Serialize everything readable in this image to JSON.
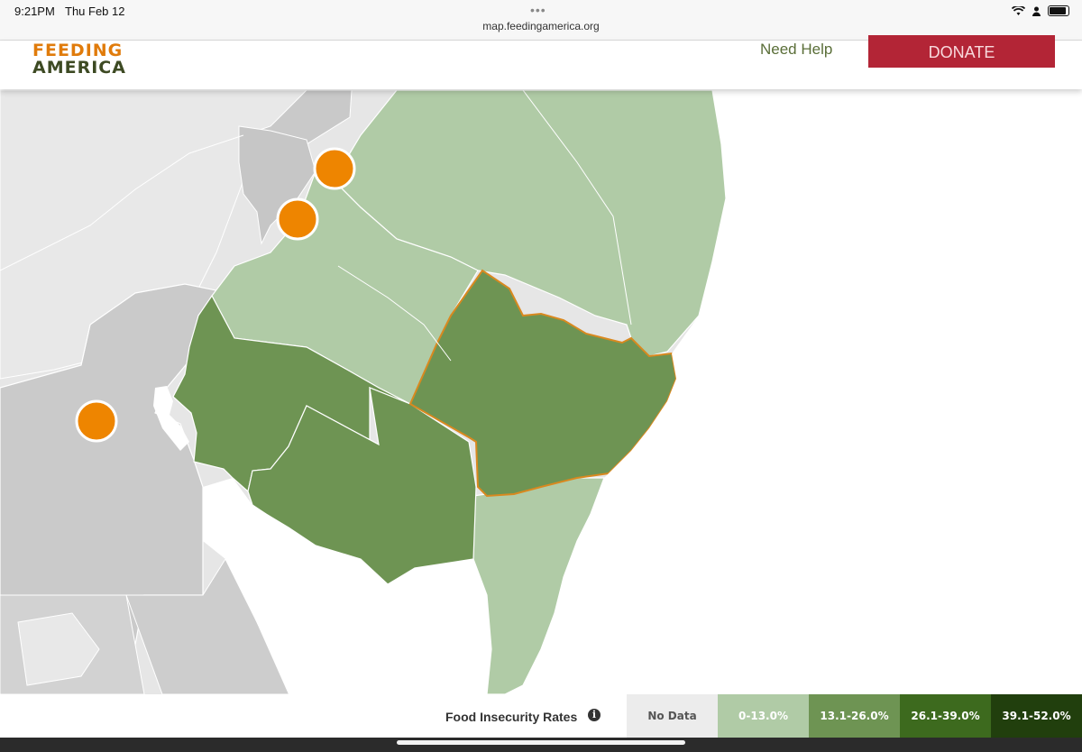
{
  "status_bar": {
    "time": "9:21PM",
    "date": "Thu Feb 12",
    "url": "map.feedingamerica.org",
    "icons": [
      "wifi-icon",
      "person-icon",
      "battery-icon"
    ]
  },
  "header": {
    "logo_line1": "FEEDING",
    "logo_line2": "AMERICA",
    "need_help": "Need Help",
    "donate": "DONATE"
  },
  "map": {
    "markers": 3,
    "highlighted_region": "orange-outlined county",
    "colors": {
      "no_data": "#c8c8c8",
      "outside": "#e6e6e6",
      "light": "#b0cba6",
      "medium": "#6e9453",
      "marker": "#ee8500",
      "highlight_border": "#d9891f"
    }
  },
  "legend": {
    "title": "Food Insecurity Rates",
    "items": [
      {
        "label": "No Data",
        "color": "#ececec",
        "text_color": "#555555"
      },
      {
        "label": "0-13.0%",
        "color": "#b0cba6",
        "text_color": "#ffffff"
      },
      {
        "label": "13.1-26.0%",
        "color": "#6e9453",
        "text_color": "#ffffff"
      },
      {
        "label": "26.1-39.0%",
        "color": "#3d6a1e",
        "text_color": "#ffffff"
      },
      {
        "label": "39.1-52.0%",
        "color": "#213f0d",
        "text_color": "#ffffff"
      }
    ]
  }
}
